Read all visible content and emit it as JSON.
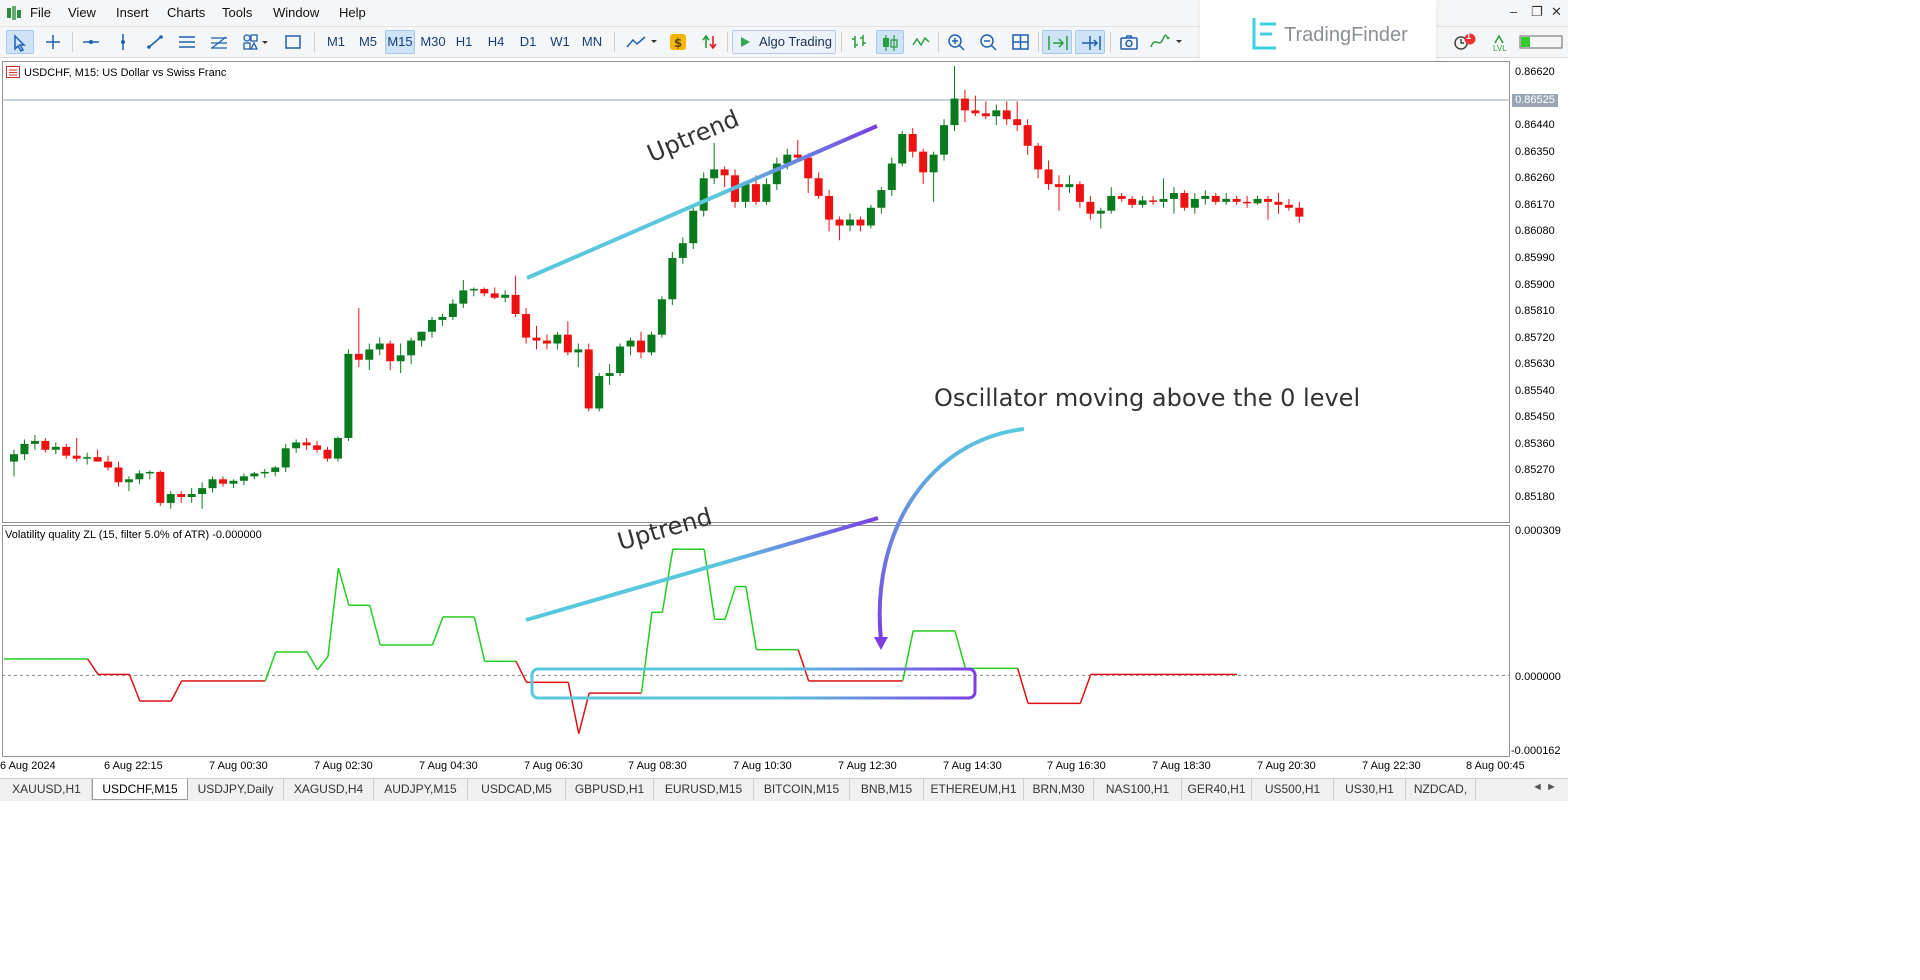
{
  "menu": {
    "items": [
      "File",
      "View",
      "Insert",
      "Charts",
      "Tools",
      "Window",
      "Help"
    ]
  },
  "toolbar": {
    "timeframes": [
      "M1",
      "M5",
      "M15",
      "M30",
      "H1",
      "H4",
      "D1",
      "W1",
      "MN"
    ],
    "active_timeframe": "M15",
    "algo_label": "Algo Trading",
    "icons": [
      "cursor-icon",
      "crosshair-icon",
      "hline-icon",
      "vline-icon",
      "trendline-icon",
      "channel-icon",
      "fibonacci-icon",
      "shapes-icon",
      "rectangle-icon",
      "indicators-icon",
      "dollar-icon",
      "signals-icon",
      "bar-chart-icon",
      "candle-chart-icon",
      "line-chart-icon",
      "zoom-in-icon",
      "zoom-out-icon",
      "grid-icon",
      "autoscroll-icon",
      "chart-shift-icon",
      "screenshot-icon",
      "templates-icon",
      "alerts-icon",
      "level-icon",
      "battery-icon"
    ],
    "alert_count": "1",
    "level_label": "LVL"
  },
  "logo": {
    "text": "TradingFinder"
  },
  "main_chart": {
    "title": "USDCHF, M15:  US Dollar vs Swiss Franc",
    "price_labels": [
      "0.86620",
      "0.86525",
      "0.86440",
      "0.86350",
      "0.86260",
      "0.86170",
      "0.86080",
      "0.85990",
      "0.85900",
      "0.85810",
      "0.85720",
      "0.85630",
      "0.85540",
      "0.85450",
      "0.85360",
      "0.85270",
      "0.85180"
    ],
    "current_price": "0.86525"
  },
  "indicator": {
    "title": "Volatility quality ZL (15, filter 5.0% of ATR) -0.000000",
    "level_labels": [
      "0.000309",
      "0.000000",
      "-0.000162"
    ]
  },
  "time_axis": [
    "6 Aug 2024",
    "6 Aug 22:15",
    "7 Aug 00:30",
    "7 Aug 02:30",
    "7 Aug 04:30",
    "7 Aug 06:30",
    "7 Aug 08:30",
    "7 Aug 10:30",
    "7 Aug 12:30",
    "7 Aug 14:30",
    "7 Aug 16:30",
    "7 Aug 18:30",
    "7 Aug 20:30",
    "7 Aug 22:30",
    "8 Aug 00:45"
  ],
  "annotations": {
    "uptrend_main": "Uptrend",
    "uptrend_sub": "Uptrend",
    "oscillator_note": "Oscillator moving above the 0 level"
  },
  "tabs": [
    "XAUUSD,H1",
    "USDCHF,M15",
    "USDJPY,Daily",
    "XAGUSD,H4",
    "AUDJPY,M15",
    "USDCAD,M5",
    "GBPUSD,H1",
    "EURUSD,M15",
    "BITCOIN,M15",
    "BNB,M15",
    "ETHEREUM,H1",
    "BRN,M30",
    "NAS100,H1",
    "GER40,H1",
    "US500,H1",
    "US30,H1",
    "NZDCAD,"
  ],
  "active_tab": "USDCHF,M15",
  "colors": {
    "bull": "#0a7a1e",
    "bear": "#ee1111",
    "osc_up": "#22cc22",
    "osc_down": "#dd1111",
    "annot_cyan": "#5ac8dc",
    "annot_purple": "#7b3fe4"
  },
  "candles": [
    {
      "o": 0.853,
      "h": 0.8534,
      "l": 0.8525,
      "c": 0.85325
    },
    {
      "o": 0.85325,
      "h": 0.85375,
      "l": 0.85305,
      "c": 0.8536
    },
    {
      "o": 0.8536,
      "h": 0.8539,
      "l": 0.8534,
      "c": 0.8537
    },
    {
      "o": 0.8537,
      "h": 0.8538,
      "l": 0.8533,
      "c": 0.8534
    },
    {
      "o": 0.8534,
      "h": 0.85365,
      "l": 0.85325,
      "c": 0.8535
    },
    {
      "o": 0.8535,
      "h": 0.8536,
      "l": 0.8531,
      "c": 0.8532
    },
    {
      "o": 0.8532,
      "h": 0.8538,
      "l": 0.853,
      "c": 0.8531
    },
    {
      "o": 0.8531,
      "h": 0.8533,
      "l": 0.8529,
      "c": 0.85315
    },
    {
      "o": 0.85315,
      "h": 0.8534,
      "l": 0.853,
      "c": 0.853
    },
    {
      "o": 0.853,
      "h": 0.8532,
      "l": 0.8527,
      "c": 0.8528
    },
    {
      "o": 0.8528,
      "h": 0.853,
      "l": 0.85215,
      "c": 0.8523
    },
    {
      "o": 0.8523,
      "h": 0.8525,
      "l": 0.852,
      "c": 0.8524
    },
    {
      "o": 0.8524,
      "h": 0.8527,
      "l": 0.85225,
      "c": 0.8526
    },
    {
      "o": 0.8526,
      "h": 0.8527,
      "l": 0.8524,
      "c": 0.85265
    },
    {
      "o": 0.85265,
      "h": 0.8527,
      "l": 0.8515,
      "c": 0.8516
    },
    {
      "o": 0.8516,
      "h": 0.852,
      "l": 0.8514,
      "c": 0.8519
    },
    {
      "o": 0.8519,
      "h": 0.852,
      "l": 0.8516,
      "c": 0.8518
    },
    {
      "o": 0.8518,
      "h": 0.8521,
      "l": 0.8516,
      "c": 0.8519
    },
    {
      "o": 0.8519,
      "h": 0.8523,
      "l": 0.8514,
      "c": 0.8521
    },
    {
      "o": 0.8521,
      "h": 0.8525,
      "l": 0.85195,
      "c": 0.8524
    },
    {
      "o": 0.8524,
      "h": 0.8525,
      "l": 0.85215,
      "c": 0.85225
    },
    {
      "o": 0.85225,
      "h": 0.8524,
      "l": 0.8521,
      "c": 0.85235
    },
    {
      "o": 0.85235,
      "h": 0.8526,
      "l": 0.8522,
      "c": 0.8525
    },
    {
      "o": 0.8525,
      "h": 0.85265,
      "l": 0.8524,
      "c": 0.8526
    },
    {
      "o": 0.8526,
      "h": 0.85275,
      "l": 0.85245,
      "c": 0.85265
    },
    {
      "o": 0.85265,
      "h": 0.85285,
      "l": 0.8525,
      "c": 0.8528
    },
    {
      "o": 0.8528,
      "h": 0.8536,
      "l": 0.85265,
      "c": 0.85345
    },
    {
      "o": 0.85345,
      "h": 0.85375,
      "l": 0.8533,
      "c": 0.85365
    },
    {
      "o": 0.85365,
      "h": 0.8538,
      "l": 0.8534,
      "c": 0.85355
    },
    {
      "o": 0.85355,
      "h": 0.8537,
      "l": 0.8533,
      "c": 0.8534
    },
    {
      "o": 0.8534,
      "h": 0.8535,
      "l": 0.853,
      "c": 0.8531
    },
    {
      "o": 0.8531,
      "h": 0.85385,
      "l": 0.853,
      "c": 0.8538
    },
    {
      "o": 0.8538,
      "h": 0.8568,
      "l": 0.8537,
      "c": 0.85665
    },
    {
      "o": 0.85665,
      "h": 0.8582,
      "l": 0.8562,
      "c": 0.85645
    },
    {
      "o": 0.85645,
      "h": 0.857,
      "l": 0.8561,
      "c": 0.8568
    },
    {
      "o": 0.8568,
      "h": 0.8572,
      "l": 0.8566,
      "c": 0.857
    },
    {
      "o": 0.857,
      "h": 0.8571,
      "l": 0.8561,
      "c": 0.8564
    },
    {
      "o": 0.8564,
      "h": 0.857,
      "l": 0.856,
      "c": 0.8566
    },
    {
      "o": 0.8566,
      "h": 0.8572,
      "l": 0.8563,
      "c": 0.8571
    },
    {
      "o": 0.8571,
      "h": 0.8574,
      "l": 0.8569,
      "c": 0.8574
    },
    {
      "o": 0.8574,
      "h": 0.8579,
      "l": 0.8572,
      "c": 0.8578
    },
    {
      "o": 0.8578,
      "h": 0.858,
      "l": 0.8576,
      "c": 0.8579
    },
    {
      "o": 0.8579,
      "h": 0.8585,
      "l": 0.8578,
      "c": 0.85835
    },
    {
      "o": 0.85835,
      "h": 0.85915,
      "l": 0.8582,
      "c": 0.8588
    },
    {
      "o": 0.8588,
      "h": 0.8589,
      "l": 0.8586,
      "c": 0.85885
    },
    {
      "o": 0.85885,
      "h": 0.8589,
      "l": 0.8586,
      "c": 0.8587
    },
    {
      "o": 0.8587,
      "h": 0.8589,
      "l": 0.8585,
      "c": 0.85855
    },
    {
      "o": 0.85855,
      "h": 0.8588,
      "l": 0.8584,
      "c": 0.85865
    },
    {
      "o": 0.85865,
      "h": 0.8593,
      "l": 0.8579,
      "c": 0.858
    },
    {
      "o": 0.858,
      "h": 0.8582,
      "l": 0.857,
      "c": 0.8572
    },
    {
      "o": 0.8572,
      "h": 0.8576,
      "l": 0.8568,
      "c": 0.8571
    },
    {
      "o": 0.8571,
      "h": 0.8573,
      "l": 0.8568,
      "c": 0.857
    },
    {
      "o": 0.857,
      "h": 0.8574,
      "l": 0.8568,
      "c": 0.8573
    },
    {
      "o": 0.8573,
      "h": 0.85775,
      "l": 0.8566,
      "c": 0.8567
    },
    {
      "o": 0.8567,
      "h": 0.857,
      "l": 0.8562,
      "c": 0.8568
    },
    {
      "o": 0.8568,
      "h": 0.857,
      "l": 0.8547,
      "c": 0.8548
    },
    {
      "o": 0.8548,
      "h": 0.856,
      "l": 0.8547,
      "c": 0.8559
    },
    {
      "o": 0.8559,
      "h": 0.8563,
      "l": 0.8556,
      "c": 0.856
    },
    {
      "o": 0.856,
      "h": 0.857,
      "l": 0.8559,
      "c": 0.8569
    },
    {
      "o": 0.8569,
      "h": 0.8572,
      "l": 0.8566,
      "c": 0.8571
    },
    {
      "o": 0.8571,
      "h": 0.8574,
      "l": 0.8565,
      "c": 0.8567
    },
    {
      "o": 0.8567,
      "h": 0.8574,
      "l": 0.8566,
      "c": 0.8573
    },
    {
      "o": 0.8573,
      "h": 0.8586,
      "l": 0.8572,
      "c": 0.8585
    },
    {
      "o": 0.8585,
      "h": 0.8601,
      "l": 0.8583,
      "c": 0.8599
    },
    {
      "o": 0.8599,
      "h": 0.8606,
      "l": 0.8597,
      "c": 0.8604
    },
    {
      "o": 0.8604,
      "h": 0.8616,
      "l": 0.8602,
      "c": 0.8615
    },
    {
      "o": 0.8615,
      "h": 0.8628,
      "l": 0.8613,
      "c": 0.8626
    },
    {
      "o": 0.8626,
      "h": 0.8638,
      "l": 0.8624,
      "c": 0.8629
    },
    {
      "o": 0.8629,
      "h": 0.863,
      "l": 0.8623,
      "c": 0.8627
    },
    {
      "o": 0.8627,
      "h": 0.8629,
      "l": 0.8616,
      "c": 0.8618
    },
    {
      "o": 0.8618,
      "h": 0.8625,
      "l": 0.8616,
      "c": 0.8624
    },
    {
      "o": 0.8624,
      "h": 0.8627,
      "l": 0.8617,
      "c": 0.8618
    },
    {
      "o": 0.8618,
      "h": 0.8626,
      "l": 0.8617,
      "c": 0.8624
    },
    {
      "o": 0.8624,
      "h": 0.8633,
      "l": 0.8622,
      "c": 0.8631
    },
    {
      "o": 0.8631,
      "h": 0.8636,
      "l": 0.8629,
      "c": 0.8634
    },
    {
      "o": 0.8634,
      "h": 0.8639,
      "l": 0.8632,
      "c": 0.8633
    },
    {
      "o": 0.8633,
      "h": 0.8634,
      "l": 0.8621,
      "c": 0.8626
    },
    {
      "o": 0.8626,
      "h": 0.8628,
      "l": 0.8619,
      "c": 0.862
    },
    {
      "o": 0.862,
      "h": 0.8622,
      "l": 0.8608,
      "c": 0.8612
    },
    {
      "o": 0.8612,
      "h": 0.8613,
      "l": 0.8605,
      "c": 0.861
    },
    {
      "o": 0.861,
      "h": 0.8614,
      "l": 0.8608,
      "c": 0.8612
    },
    {
      "o": 0.8612,
      "h": 0.8613,
      "l": 0.8608,
      "c": 0.861
    },
    {
      "o": 0.861,
      "h": 0.8617,
      "l": 0.8609,
      "c": 0.8616
    },
    {
      "o": 0.8616,
      "h": 0.8623,
      "l": 0.8614,
      "c": 0.8622
    },
    {
      "o": 0.8622,
      "h": 0.8633,
      "l": 0.862,
      "c": 0.8631
    },
    {
      "o": 0.8631,
      "h": 0.8642,
      "l": 0.863,
      "c": 0.8641
    },
    {
      "o": 0.8641,
      "h": 0.8643,
      "l": 0.8633,
      "c": 0.8635
    },
    {
      "o": 0.8635,
      "h": 0.8636,
      "l": 0.8624,
      "c": 0.8628
    },
    {
      "o": 0.8628,
      "h": 0.8635,
      "l": 0.8618,
      "c": 0.8634
    },
    {
      "o": 0.8634,
      "h": 0.8646,
      "l": 0.8632,
      "c": 0.8644
    },
    {
      "o": 0.8644,
      "h": 0.8664,
      "l": 0.8642,
      "c": 0.8653
    },
    {
      "o": 0.8653,
      "h": 0.8656,
      "l": 0.8645,
      "c": 0.8649
    },
    {
      "o": 0.8649,
      "h": 0.8654,
      "l": 0.8647,
      "c": 0.8648
    },
    {
      "o": 0.8648,
      "h": 0.8652,
      "l": 0.8646,
      "c": 0.8647
    },
    {
      "o": 0.8647,
      "h": 0.8651,
      "l": 0.8644,
      "c": 0.8649
    },
    {
      "o": 0.8649,
      "h": 0.8652,
      "l": 0.8644,
      "c": 0.8646
    },
    {
      "o": 0.8646,
      "h": 0.8652,
      "l": 0.8642,
      "c": 0.8644
    },
    {
      "o": 0.8644,
      "h": 0.8646,
      "l": 0.8634,
      "c": 0.8637
    },
    {
      "o": 0.8637,
      "h": 0.8638,
      "l": 0.8626,
      "c": 0.8629
    },
    {
      "o": 0.8629,
      "h": 0.8632,
      "l": 0.8622,
      "c": 0.8624
    },
    {
      "o": 0.8624,
      "h": 0.8627,
      "l": 0.8615,
      "c": 0.8623
    },
    {
      "o": 0.8623,
      "h": 0.8627,
      "l": 0.8621,
      "c": 0.8624
    },
    {
      "o": 0.8624,
      "h": 0.8625,
      "l": 0.8616,
      "c": 0.8618
    },
    {
      "o": 0.8618,
      "h": 0.862,
      "l": 0.8612,
      "c": 0.8614
    },
    {
      "o": 0.8614,
      "h": 0.8616,
      "l": 0.8609,
      "c": 0.8615
    },
    {
      "o": 0.8615,
      "h": 0.8623,
      "l": 0.8614,
      "c": 0.862
    },
    {
      "o": 0.862,
      "h": 0.8621,
      "l": 0.8618,
      "c": 0.8619
    },
    {
      "o": 0.8619,
      "h": 0.862,
      "l": 0.8616,
      "c": 0.8617
    },
    {
      "o": 0.8617,
      "h": 0.862,
      "l": 0.8616,
      "c": 0.86185
    },
    {
      "o": 0.86185,
      "h": 0.862,
      "l": 0.8617,
      "c": 0.8618
    },
    {
      "o": 0.8618,
      "h": 0.8626,
      "l": 0.8616,
      "c": 0.8619
    },
    {
      "o": 0.8619,
      "h": 0.8623,
      "l": 0.8614,
      "c": 0.8621
    },
    {
      "o": 0.8621,
      "h": 0.8622,
      "l": 0.8615,
      "c": 0.8616
    },
    {
      "o": 0.8616,
      "h": 0.8621,
      "l": 0.8614,
      "c": 0.8619
    },
    {
      "o": 0.8619,
      "h": 0.8622,
      "l": 0.8617,
      "c": 0.862
    },
    {
      "o": 0.862,
      "h": 0.8621,
      "l": 0.8617,
      "c": 0.8618
    },
    {
      "o": 0.8618,
      "h": 0.8621,
      "l": 0.8617,
      "c": 0.8619
    },
    {
      "o": 0.8619,
      "h": 0.862,
      "l": 0.8617,
      "c": 0.8618
    },
    {
      "o": 0.8618,
      "h": 0.862,
      "l": 0.8616,
      "c": 0.86175
    },
    {
      "o": 0.86175,
      "h": 0.862,
      "l": 0.8617,
      "c": 0.8619
    },
    {
      "o": 0.8619,
      "h": 0.862,
      "l": 0.8612,
      "c": 0.8618
    },
    {
      "o": 0.8618,
      "h": 0.8621,
      "l": 0.8614,
      "c": 0.8617
    },
    {
      "o": 0.8617,
      "h": 0.8619,
      "l": 0.8615,
      "c": 0.8616
    },
    {
      "o": 0.8616,
      "h": 0.8618,
      "l": 0.8611,
      "c": 0.8613
    }
  ],
  "oscillator": [
    {
      "v": 3.5e-05,
      "d": "up"
    },
    {
      "v": 3.5e-05,
      "d": "up"
    },
    {
      "v": 3.5e-05,
      "d": "up"
    },
    {
      "v": 3.5e-05,
      "d": "up"
    },
    {
      "v": 3.5e-05,
      "d": "up"
    },
    {
      "v": 3.5e-05,
      "d": "up"
    },
    {
      "v": 3.5e-05,
      "d": "up"
    },
    {
      "v": 3.5e-05,
      "d": "up"
    },
    {
      "v": 3.5e-05,
      "d": "up"
    },
    {
      "v": 2e-06,
      "d": "down"
    },
    {
      "v": 2e-06,
      "d": "down"
    },
    {
      "v": 2e-06,
      "d": "down"
    },
    {
      "v": 2e-06,
      "d": "down"
    },
    {
      "v": -5.5e-05,
      "d": "down"
    },
    {
      "v": -5.5e-05,
      "d": "down"
    },
    {
      "v": -5.5e-05,
      "d": "down"
    },
    {
      "v": -5.5e-05,
      "d": "down"
    },
    {
      "v": -1.2e-05,
      "d": "down"
    },
    {
      "v": -1.2e-05,
      "d": "down"
    },
    {
      "v": -1.2e-05,
      "d": "down"
    },
    {
      "v": -1.2e-05,
      "d": "down"
    },
    {
      "v": -1.2e-05,
      "d": "down"
    },
    {
      "v": -1.2e-05,
      "d": "down"
    },
    {
      "v": -1.2e-05,
      "d": "down"
    },
    {
      "v": -1.2e-05,
      "d": "down"
    },
    {
      "v": -1.2e-05,
      "d": "down"
    },
    {
      "v": 5e-05,
      "d": "up"
    },
    {
      "v": 5e-05,
      "d": "up"
    },
    {
      "v": 5e-05,
      "d": "up"
    },
    {
      "v": 5e-05,
      "d": "up"
    },
    {
      "v": 1.2e-05,
      "d": "up"
    },
    {
      "v": 4e-05,
      "d": "up"
    },
    {
      "v": 0.00023,
      "d": "up"
    },
    {
      "v": 0.00015,
      "d": "up"
    },
    {
      "v": 0.00015,
      "d": "up"
    },
    {
      "v": 0.00015,
      "d": "up"
    },
    {
      "v": 6.5e-05,
      "d": "up"
    },
    {
      "v": 6.5e-05,
      "d": "up"
    },
    {
      "v": 6.5e-05,
      "d": "up"
    },
    {
      "v": 6.5e-05,
      "d": "up"
    },
    {
      "v": 6.5e-05,
      "d": "up"
    },
    {
      "v": 6.5e-05,
      "d": "up"
    },
    {
      "v": 0.000125,
      "d": "up"
    },
    {
      "v": 0.000125,
      "d": "up"
    },
    {
      "v": 0.000125,
      "d": "up"
    },
    {
      "v": 0.000125,
      "d": "up"
    },
    {
      "v": 3e-05,
      "d": "up"
    },
    {
      "v": 3e-05,
      "d": "up"
    },
    {
      "v": 3e-05,
      "d": "up"
    },
    {
      "v": 3e-05,
      "d": "up"
    },
    {
      "v": -1.5e-05,
      "d": "down"
    },
    {
      "v": -1.5e-05,
      "d": "down"
    },
    {
      "v": -1.5e-05,
      "d": "down"
    },
    {
      "v": -1.5e-05,
      "d": "down"
    },
    {
      "v": -1.5e-05,
      "d": "down"
    },
    {
      "v": -0.000125,
      "d": "down"
    },
    {
      "v": -3.8e-05,
      "d": "down"
    },
    {
      "v": -3.8e-05,
      "d": "down"
    },
    {
      "v": -3.8e-05,
      "d": "down"
    },
    {
      "v": -3.8e-05,
      "d": "down"
    },
    {
      "v": -3.8e-05,
      "d": "down"
    },
    {
      "v": -3.8e-05,
      "d": "down"
    },
    {
      "v": 0.000135,
      "d": "up"
    },
    {
      "v": 0.000135,
      "d": "up"
    },
    {
      "v": 0.00027,
      "d": "up"
    },
    {
      "v": 0.00027,
      "d": "up"
    },
    {
      "v": 0.00027,
      "d": "up"
    },
    {
      "v": 0.00027,
      "d": "up"
    },
    {
      "v": 0.00012,
      "d": "up"
    },
    {
      "v": 0.00012,
      "d": "up"
    },
    {
      "v": 0.00019,
      "d": "up"
    },
    {
      "v": 0.00019,
      "d": "up"
    },
    {
      "v": 5.5e-05,
      "d": "up"
    },
    {
      "v": 5.5e-05,
      "d": "up"
    },
    {
      "v": 5.5e-05,
      "d": "up"
    },
    {
      "v": 5.5e-05,
      "d": "up"
    },
    {
      "v": 5.5e-05,
      "d": "up"
    },
    {
      "v": -1.2e-05,
      "d": "down"
    },
    {
      "v": -1.2e-05,
      "d": "down"
    },
    {
      "v": -1.2e-05,
      "d": "down"
    },
    {
      "v": -1.2e-05,
      "d": "down"
    },
    {
      "v": -1.2e-05,
      "d": "down"
    },
    {
      "v": -1.2e-05,
      "d": "down"
    },
    {
      "v": -1.2e-05,
      "d": "down"
    },
    {
      "v": -1.2e-05,
      "d": "down"
    },
    {
      "v": -1.2e-05,
      "d": "down"
    },
    {
      "v": -1.2e-05,
      "d": "down"
    },
    {
      "v": 9.5e-05,
      "d": "up"
    },
    {
      "v": 9.5e-05,
      "d": "up"
    },
    {
      "v": 9.5e-05,
      "d": "up"
    },
    {
      "v": 9.5e-05,
      "d": "up"
    },
    {
      "v": 9.5e-05,
      "d": "up"
    },
    {
      "v": 1.5e-05,
      "d": "up"
    },
    {
      "v": 1.5e-05,
      "d": "up"
    },
    {
      "v": 1.5e-05,
      "d": "up"
    },
    {
      "v": 1.5e-05,
      "d": "up"
    },
    {
      "v": 1.5e-05,
      "d": "up"
    },
    {
      "v": 1.5e-05,
      "d": "up"
    },
    {
      "v": -6e-05,
      "d": "down"
    },
    {
      "v": -6e-05,
      "d": "down"
    },
    {
      "v": -6e-05,
      "d": "down"
    },
    {
      "v": -6e-05,
      "d": "down"
    },
    {
      "v": -6e-05,
      "d": "down"
    },
    {
      "v": -6e-05,
      "d": "down"
    },
    {
      "v": 2e-06,
      "d": "down"
    },
    {
      "v": 2e-06,
      "d": "down"
    },
    {
      "v": 2e-06,
      "d": "down"
    },
    {
      "v": 2e-06,
      "d": "down"
    },
    {
      "v": 2e-06,
      "d": "down"
    },
    {
      "v": 2e-06,
      "d": "down"
    },
    {
      "v": 2e-06,
      "d": "down"
    },
    {
      "v": 2e-06,
      "d": "down"
    },
    {
      "v": 2e-06,
      "d": "down"
    },
    {
      "v": 2e-06,
      "d": "down"
    },
    {
      "v": 2e-06,
      "d": "down"
    },
    {
      "v": 2e-06,
      "d": "down"
    },
    {
      "v": 2e-06,
      "d": "down"
    },
    {
      "v": 2e-06,
      "d": "down"
    },
    {
      "v": 2e-06,
      "d": "down"
    }
  ]
}
